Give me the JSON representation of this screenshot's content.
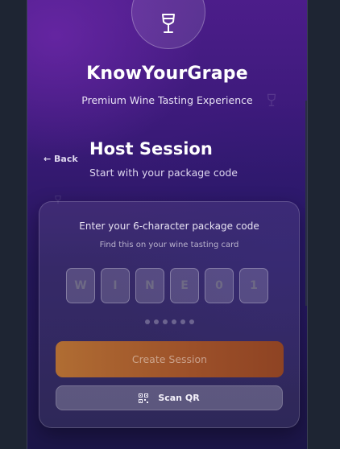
{
  "header": {
    "app_title": "KnowYourGrape",
    "app_subtitle": "Premium Wine Tasting Experience",
    "logo_icon": "wine-glass-icon"
  },
  "nav": {
    "back_label": "← Back"
  },
  "section": {
    "title": "Host Session",
    "subtitle": "Start with your package code"
  },
  "card": {
    "prompt": "Enter your 6-character package code",
    "hint": "Find this on your wine tasting card",
    "code_chars": [
      "W",
      "I",
      "N",
      "E",
      "0",
      "1"
    ],
    "progress_dots_total": 6,
    "progress_dots_filled": 0,
    "create_label": "Create Session",
    "scan_label": "Scan QR",
    "scan_icon": "qr-code-icon"
  },
  "colors": {
    "accent_orange": "#b06d33",
    "background_purple": "#4c1d8a"
  }
}
